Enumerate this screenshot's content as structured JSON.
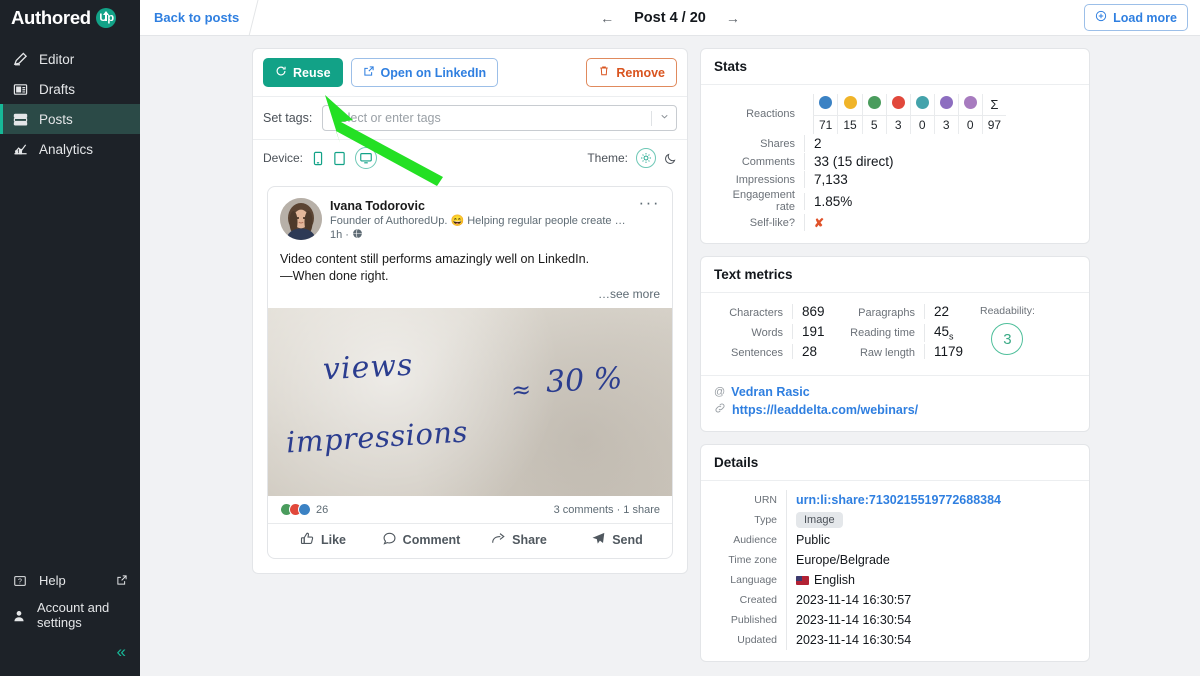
{
  "brand": {
    "name": "Authored",
    "badge": "Up",
    "accent": "#12a287"
  },
  "sidebar": {
    "items": [
      {
        "label": "Editor",
        "icon": "pencil-icon",
        "active": false
      },
      {
        "label": "Drafts",
        "icon": "drafts-icon",
        "active": false
      },
      {
        "label": "Posts",
        "icon": "posts-icon",
        "active": true
      },
      {
        "label": "Analytics",
        "icon": "analytics-icon",
        "active": false
      }
    ],
    "bottom": [
      {
        "label": "Help",
        "icon": "help-icon",
        "trailing": "external-link-icon"
      },
      {
        "label": "Account and settings",
        "icon": "user-icon"
      }
    ],
    "collapse": "«"
  },
  "topbar": {
    "back_label": "Back to posts",
    "prev": "←",
    "next": "→",
    "title": "Post 4 / 20",
    "load_more": "Load more",
    "load_more_icon": "plus-circle-icon"
  },
  "actions": {
    "reuse": "Reuse",
    "open_linkedin": "Open on LinkedIn",
    "remove": "Remove"
  },
  "tags": {
    "label": "Set tags:",
    "placeholder": "Select or enter tags",
    "value": ""
  },
  "device": {
    "label": "Device:",
    "options": [
      "mobile-icon",
      "tablet-icon",
      "desktop-icon"
    ],
    "selected": "desktop-icon"
  },
  "theme": {
    "label": "Theme:",
    "options": [
      "light-sun-icon",
      "dark-moon-icon"
    ],
    "selected": "light-sun-icon"
  },
  "preview": {
    "author_name": "Ivana Todorovic",
    "author_headline": "Founder of AuthoredUp. 😄 Helping regular people create content on Li…",
    "time": "1h",
    "visibility_icon": "globe-icon",
    "menu_icon": "more-dots-icon",
    "body_line1": "Video content still performs amazingly well on LinkedIn.",
    "body_line2": "—When done right.",
    "see_more": "…see more",
    "image_alt": "handwritten-note",
    "image_text": {
      "numerator": "views",
      "denominator": "impressions",
      "approx": "≈",
      "value": "30 %"
    },
    "reaction_count": "26",
    "comments_shares": "3 comments · 1 share",
    "actions": [
      {
        "label": "Like",
        "icon": "thumbs-up-icon"
      },
      {
        "label": "Comment",
        "icon": "comment-bubble-icon"
      },
      {
        "label": "Share",
        "icon": "share-arrow-icon"
      },
      {
        "label": "Send",
        "icon": "send-plane-icon"
      }
    ]
  },
  "stats": {
    "title": "Stats",
    "reactions_label": "Reactions",
    "reactions": [
      {
        "name": "like",
        "color": "#3b82c4",
        "value": "71"
      },
      {
        "name": "insightful",
        "color": "#f0b429",
        "value": "15"
      },
      {
        "name": "celebrate",
        "color": "#4a9c5d",
        "value": "5"
      },
      {
        "name": "love",
        "color": "#e1483b",
        "value": "3"
      },
      {
        "name": "funny",
        "color": "#44a3ab",
        "value": "0"
      },
      {
        "name": "support",
        "color": "#8d6ec0",
        "value": "3"
      },
      {
        "name": "curious",
        "color": "#a77bbf",
        "value": "0"
      }
    ],
    "total_symbol": "Σ",
    "total_value": "97",
    "rows": [
      {
        "label": "Shares",
        "value": "2"
      },
      {
        "label": "Comments",
        "value": "33 (15 direct)"
      },
      {
        "label": "Impressions",
        "value": "7,133"
      },
      {
        "label": "Engagement rate",
        "value": "1.85%"
      }
    ],
    "self_like_label": "Self-like?",
    "self_like_value": "✘"
  },
  "text_metrics": {
    "title": "Text metrics",
    "left": [
      {
        "label": "Characters",
        "value": "869"
      },
      {
        "label": "Words",
        "value": "191"
      },
      {
        "label": "Sentences",
        "value": "28"
      }
    ],
    "right": [
      {
        "label": "Paragraphs",
        "value": "22"
      },
      {
        "label": "Reading time",
        "value": "45",
        "suffix": "s"
      },
      {
        "label": "Raw length",
        "value": "1179"
      }
    ],
    "readability_label": "Readability:",
    "readability_value": "3",
    "mention": "Vedran Rasic",
    "mention_icon": "at-icon",
    "link": "https://leaddelta.com/webinars/",
    "link_icon": "link-icon"
  },
  "details": {
    "title": "Details",
    "rows": [
      {
        "label": "URN",
        "value": "urn:li:share:7130215519772688384",
        "type": "link"
      },
      {
        "label": "Type",
        "value": "Image",
        "type": "chip"
      },
      {
        "label": "Audience",
        "value": "Public",
        "type": "text"
      },
      {
        "label": "Time zone",
        "value": "Europe/Belgrade",
        "type": "text"
      },
      {
        "label": "Language",
        "value": "English",
        "type": "flag"
      },
      {
        "label": "Created",
        "value": "2023-11-14 16:30:57",
        "type": "text"
      },
      {
        "label": "Published",
        "value": "2023-11-14 16:30:54",
        "type": "text"
      },
      {
        "label": "Updated",
        "value": "2023-11-14 16:30:54",
        "type": "text"
      }
    ]
  },
  "annotation": {
    "type": "arrow",
    "color": "#24e024",
    "points_to": "reuse-button"
  }
}
